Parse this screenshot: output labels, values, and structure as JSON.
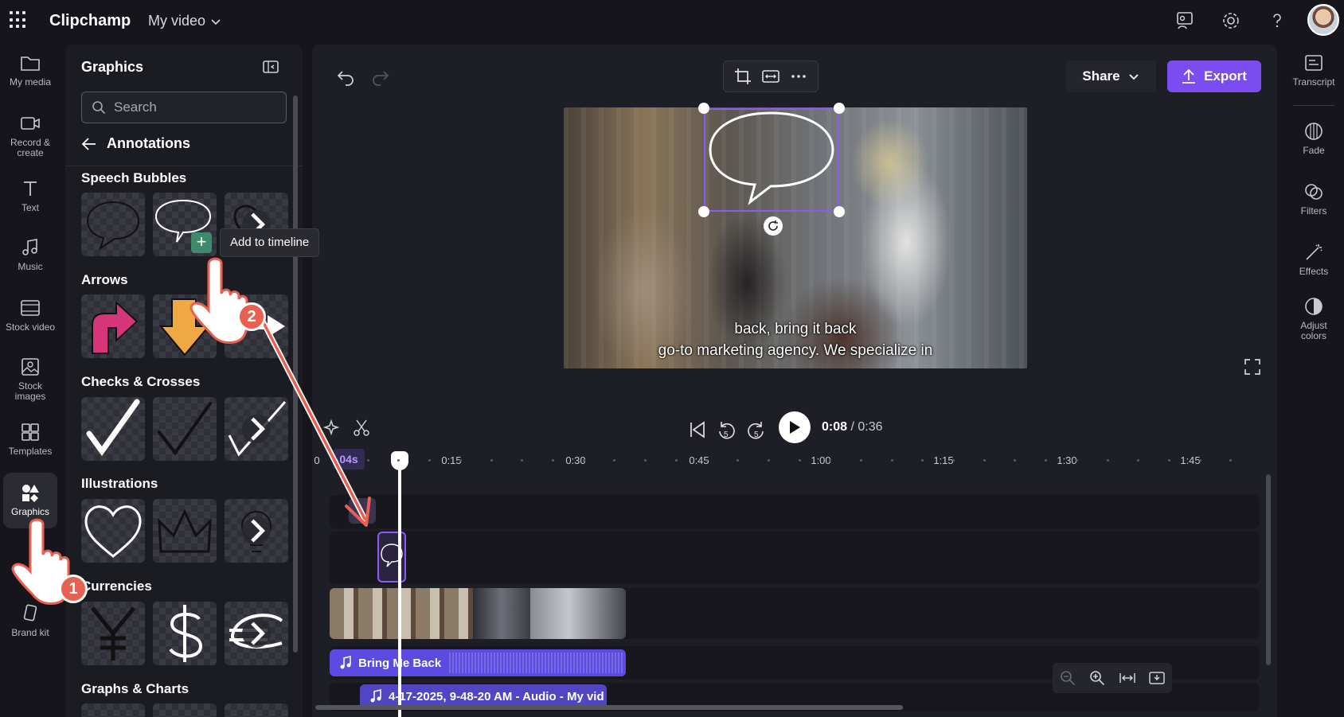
{
  "app": {
    "title": "Clipchamp",
    "project_name": "My video"
  },
  "left_rail": [
    {
      "label": "My media",
      "icon": "folder-icon"
    },
    {
      "label": "Record & create",
      "icon": "camera-icon"
    },
    {
      "label": "Text",
      "icon": "text-icon"
    },
    {
      "label": "Music",
      "icon": "music-icon"
    },
    {
      "label": "Stock video",
      "icon": "film-icon"
    },
    {
      "label": "Stock images",
      "icon": "image-icon"
    },
    {
      "label": "Templates",
      "icon": "templates-icon"
    },
    {
      "label": "Graphics",
      "icon": "shapes-icon",
      "active": true
    },
    {
      "label": "Brand kit",
      "icon": "brand-kit-icon"
    }
  ],
  "panel": {
    "title": "Graphics",
    "search_placeholder": "Search",
    "back_label": "Annotations",
    "sections": [
      "Speech Bubbles",
      "Arrows",
      "Checks & Crosses",
      "Illustrations",
      "Currencies",
      "Graphs & Charts"
    ],
    "add_button": "+",
    "tooltip": "Add to timeline"
  },
  "preview": {
    "caption_line1": "back, bring it back",
    "caption_line2": "go-to marketing agency. We specialize in"
  },
  "toolbar": {
    "share_label": "Share",
    "export_label": "Export"
  },
  "playback": {
    "current_time": "0:08",
    "total_time": "/ 0:36",
    "skip_back": "5",
    "skip_forward": "5"
  },
  "timeline": {
    "time_pill": "04s",
    "ruler": [
      "0",
      "0:15",
      "0:30",
      "0:45",
      "1:00",
      "1:15",
      "1:30",
      "1:45"
    ],
    "audio_track_1": "Bring Me Back",
    "audio_track_2": "4-17-2025, 9-48-20 AM - Audio - My vid"
  },
  "right_rail": [
    {
      "label": "Transcript",
      "icon": "transcript-icon"
    },
    {
      "label": "Fade",
      "icon": "fade-icon"
    },
    {
      "label": "Filters",
      "icon": "filters-icon"
    },
    {
      "label": "Effects",
      "icon": "effects-icon"
    },
    {
      "label": "Adjust colors",
      "icon": "adjust-colors-icon"
    }
  ],
  "tutorial": {
    "step1": "1",
    "step2": "2"
  },
  "colors": {
    "accent": "#7b4cf0",
    "selection": "#8a5cf6",
    "annotation": "#e8604f",
    "add_button": "#3d8a6c"
  }
}
